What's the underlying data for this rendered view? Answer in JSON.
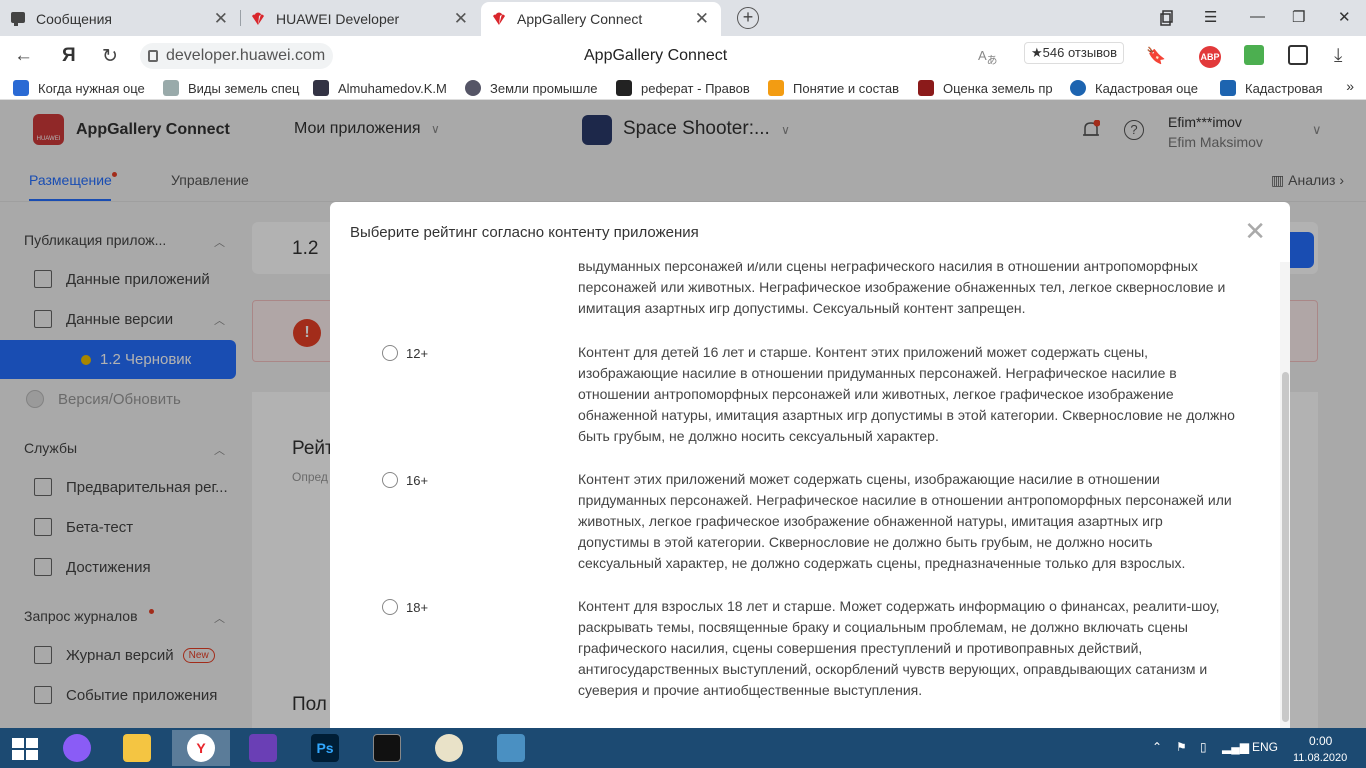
{
  "browser": {
    "tabs": [
      {
        "title": "Сообщения"
      },
      {
        "title": "HUAWEI Developer"
      },
      {
        "title": "AppGallery Connect"
      }
    ],
    "url": "developer.huawei.com",
    "page_title": "AppGallery Connect",
    "reviews": "★546 отзывов",
    "abp_label": "ABP",
    "bookmarks": [
      "Когда нужная оце",
      "Виды земель спец",
      "Almuhamedov.K.M",
      "Земли промышле",
      "реферат - Правов",
      "Понятие и состав",
      "Оценка земель пр",
      "Кадастровая оце",
      "Кадастровая"
    ]
  },
  "app": {
    "brand_small": "HUAWEI",
    "name": "AppGallery Connect",
    "my_apps": "Мои приложения",
    "project": "Space Shooter:...",
    "user_login": "Efim***imov",
    "user_name": "Efim Maksimov",
    "help": "?",
    "subnav": {
      "tab1": "Размещение",
      "tab2": "Управление",
      "analytics": "Анализ"
    }
  },
  "sidebar": {
    "publish_section": "Публикация прилож...",
    "app_data": "Данные приложений",
    "version_data": "Данные версии",
    "active_version": "1.2 Черновик",
    "version_update": "Версия/Обновить",
    "services_section": "Службы",
    "preorder": "Предварительная рег...",
    "beta": "Бета-тест",
    "achievements": "Достижения",
    "logs_section": "Запрос журналов",
    "version_log": "Журнал версий",
    "new_badge": "New",
    "app_event": "Событие приложения"
  },
  "main": {
    "version": "1.2",
    "alert_icon": "!",
    "rating_heading": "Рейт",
    "rating_sub": "Опред",
    "bottom_heading": "Пол"
  },
  "modal": {
    "title": "Выберите рейтинг согласно контенту приложения",
    "partial_text": "выдуманных персонажей и/или сцены неграфического насилия в отношении антропоморфных персонажей или животных. Неграфическое изображение обнаженных тел, легкое сквернословие и имитация азартных игр допустимы. Сексуальный контент запрещен.",
    "options": [
      {
        "label": "12+",
        "desc": "Контент для детей 16 лет и старше. Контент этих приложений может содержать сцены, изображающие насилие в отношении придуманных персонажей. Неграфическое насилие в отношении антропоморфных персонажей или животных, легкое графическое изображение обнаженной натуры, имитация азартных игр допустимы в этой категории. Сквернословие не должно быть грубым, не должно носить сексуальный характер."
      },
      {
        "label": "16+",
        "desc": "Контент этих приложений может содержать сцены, изображающие насилие в отношении придуманных персонажей. Неграфическое насилие в отношении антропоморфных персонажей или животных, легкое графическое изображение обнаженной натуры, имитация азартных игр допустимы в этой категории. Сквернословие не должно быть грубым, не должно носить сексуальный характер, не должно содержать сцены, предназначенные только для взрослых."
      },
      {
        "label": "18+",
        "desc": "Контент для взрослых 18 лет и старше. Может содержать информацию о финансах, реалити-шоу, раскрывать темы, посвященные браку и социальным проблемам, не должно включать сцены графического насилия, сцены совершения преступлений и противоправных действий, антигосударственных выступлений, оскорблений чувств верующих, оправдывающих сатанизм и суеверия и прочие антиобщественные выступления."
      }
    ]
  },
  "taskbar": {
    "ps_label": "Ps",
    "lang": "ENG",
    "time": "0:00",
    "date": "11.08.2020"
  },
  "colors": {
    "accent": "#256fff",
    "brand": "#cf3a3a",
    "taskbar": "#1c4a72"
  }
}
